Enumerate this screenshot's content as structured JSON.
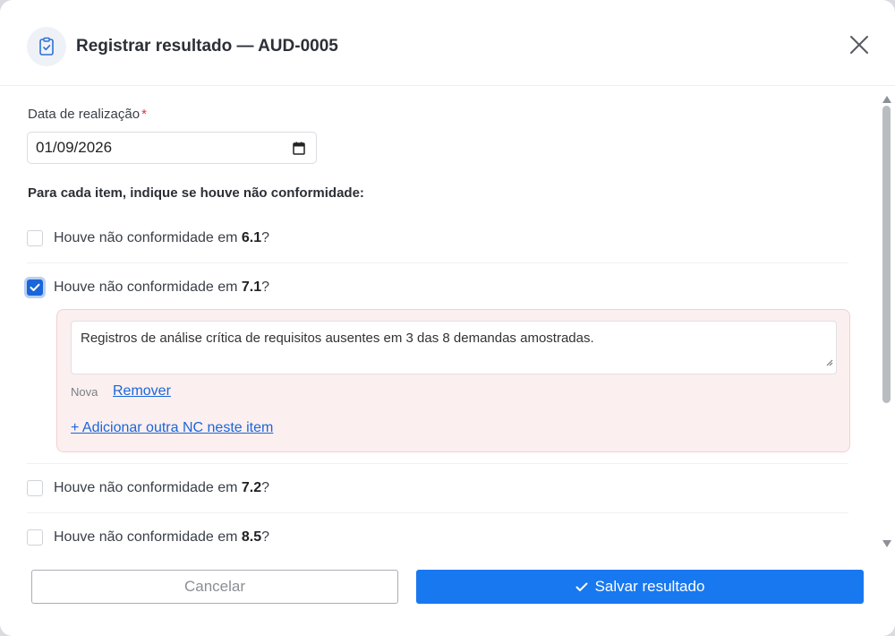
{
  "dialog": {
    "title": "Registrar resultado — AUD-0005",
    "header_icon": "clipboard-check-icon",
    "close_icon": "close-icon"
  },
  "form": {
    "date_label": "Data de realização",
    "required_marker": "*",
    "date_value": "01/09/2026",
    "section_title": "Para cada item, indique se houve não conformidade:"
  },
  "items": [
    {
      "prefix": "Houve não conformidade em ",
      "code": "6.1",
      "suffix": "?",
      "checked": false
    },
    {
      "prefix": "Houve não conformidade em ",
      "code": "7.1",
      "suffix": "?",
      "checked": true
    },
    {
      "prefix": "Houve não conformidade em ",
      "code": "7.2",
      "suffix": "?",
      "checked": false
    },
    {
      "prefix": "Houve não conformidade em ",
      "code": "8.5",
      "suffix": "?",
      "checked": false
    }
  ],
  "nc_block": {
    "text": "Registros de análise crítica de requisitos ausentes em 3 das 8 demandas amostradas.",
    "badge": "Nova",
    "remove_label": "Remover",
    "add_label": "+ Adicionar outra NC neste item"
  },
  "footer": {
    "cancel_label": "Cancelar",
    "save_label": "Salvar resultado"
  },
  "colors": {
    "primary": "#1878f0",
    "checkbox_checked": "#1a66d9",
    "nc_background": "#fcefef",
    "nc_border": "#f3d0d0",
    "required": "#d9363e"
  }
}
